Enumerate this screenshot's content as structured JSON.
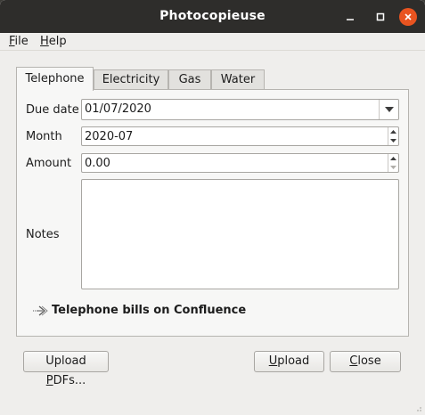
{
  "window": {
    "title": "Photocopieuse"
  },
  "menubar": {
    "file": {
      "mnemonic": "F",
      "rest": "ile"
    },
    "help": {
      "mnemonic": "H",
      "rest": "elp"
    }
  },
  "tabs": [
    {
      "label": "Telephone",
      "active": true
    },
    {
      "label": "Electricity",
      "active": false
    },
    {
      "label": "Gas",
      "active": false
    },
    {
      "label": "Water",
      "active": false
    }
  ],
  "form": {
    "due_date": {
      "label": "Due date",
      "value": "01/07/2020"
    },
    "month": {
      "label": "Month",
      "value": "2020-07"
    },
    "amount": {
      "label": "Amount",
      "value": "0.00"
    },
    "notes": {
      "label": "Notes",
      "value": ""
    }
  },
  "link": {
    "text": "Telephone bills on Confluence",
    "icon": "link-arrow-icon"
  },
  "buttons": {
    "upload_pdfs": {
      "mnemonic": "P",
      "before": "Upload ",
      "after": "DFs..."
    },
    "upload": {
      "mnemonic": "U",
      "rest": "pload"
    },
    "close": {
      "mnemonic": "C",
      "rest": "lose"
    }
  },
  "colors": {
    "titlebar": "#2e2d2b",
    "close_button": "#e95420",
    "window_bg": "#efeeec",
    "panel_bg": "#f7f7f6"
  }
}
